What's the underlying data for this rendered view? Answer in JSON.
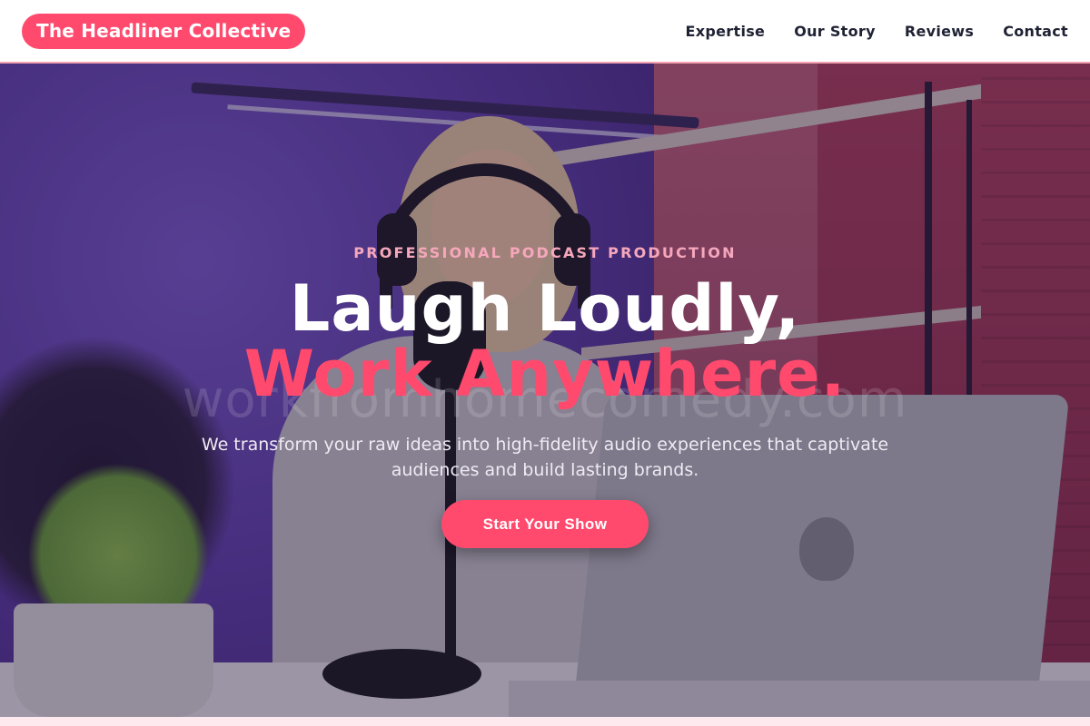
{
  "header": {
    "brand": "The Headliner Collective",
    "nav": [
      "Expertise",
      "Our Story",
      "Reviews",
      "Contact"
    ]
  },
  "hero": {
    "eyebrow": "PROFESSIONAL PODCAST PRODUCTION",
    "headline_line1": "Laugh Loudly,",
    "headline_line2": "Work Anywhere.",
    "subtext": "We transform your raw ideas into high-fidelity audio experiences that captivate audiences and build lasting brands.",
    "cta_label": "Start Your Show",
    "background_watermark": "workfromhomecomedy.com"
  },
  "colors": {
    "accent": "#ff4a6e",
    "nav_text": "#1e2233",
    "eyebrow": "#f6a7bb"
  }
}
